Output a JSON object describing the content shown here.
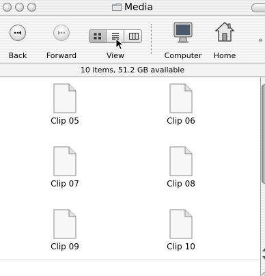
{
  "window": {
    "title": "Media"
  },
  "toolbar": {
    "back_label": "Back",
    "forward_label": "Forward",
    "view_label": "View",
    "computer_label": "Computer",
    "home_label": "Home",
    "overflow": "»",
    "view_modes": [
      "icon",
      "list",
      "column"
    ],
    "selected_view": "icon"
  },
  "status": {
    "text": "10 items, 51.2 GB available"
  },
  "files": [
    {
      "name": "Clip 05"
    },
    {
      "name": "Clip 06"
    },
    {
      "name": "Clip 07"
    },
    {
      "name": "Clip 08"
    },
    {
      "name": "Clip 09"
    },
    {
      "name": "Clip 10"
    }
  ],
  "icons": [
    "back-icon",
    "forward-icon",
    "icon-view-icon",
    "list-view-icon",
    "column-view-icon",
    "computer-icon",
    "home-icon",
    "document-icon",
    "folder-icon"
  ]
}
